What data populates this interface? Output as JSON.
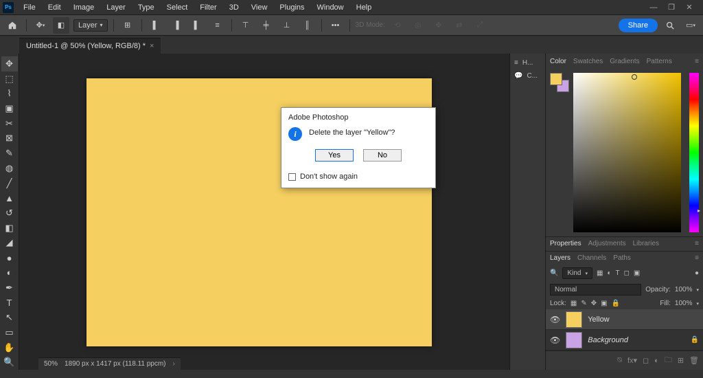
{
  "app": {
    "logo": "Ps"
  },
  "menu": [
    "File",
    "Edit",
    "Image",
    "Layer",
    "Type",
    "Select",
    "Filter",
    "3D",
    "View",
    "Plugins",
    "Window",
    "Help"
  ],
  "optbar": {
    "layer_select": "Layer",
    "mode_label": "3D Mode:",
    "share": "Share"
  },
  "doc": {
    "tab_title": "Untitled-1 @ 50% (Yellow, RGB/8) *"
  },
  "dialog": {
    "title": "Adobe Photoshop",
    "message": "Delete the layer \"Yellow\"?",
    "yes": "Yes",
    "no": "No",
    "dont_show": "Don't show again"
  },
  "mini_panels": [
    {
      "label": "H..."
    },
    {
      "label": "C..."
    }
  ],
  "right": {
    "color_tabs": [
      "Color",
      "Swatches",
      "Gradients",
      "Patterns"
    ],
    "prop_tabs": [
      "Properties",
      "Adjustments",
      "Libraries"
    ],
    "layer_tabs": [
      "Layers",
      "Channels",
      "Paths"
    ],
    "kind_label": "Kind",
    "blend": {
      "mode": "Normal",
      "opacity_label": "Opacity:",
      "opacity": "100%",
      "lock_label": "Lock:",
      "fill_label": "Fill:",
      "fill": "100%"
    },
    "layers": [
      {
        "name": "Yellow",
        "color": "#f5cf60",
        "selected": true,
        "bg": false,
        "locked": false
      },
      {
        "name": "Background",
        "color": "#c9a3e6",
        "selected": false,
        "bg": true,
        "locked": true
      }
    ]
  },
  "status": {
    "zoom": "50%",
    "dims": "1890 px x 1417 px (118.11 ppcm)"
  }
}
